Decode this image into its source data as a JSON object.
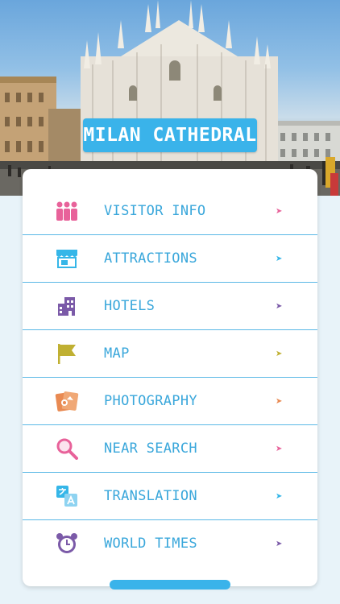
{
  "header": {
    "title": "MILAN CATHEDRAL"
  },
  "menu": {
    "items": [
      {
        "label": "VISITOR INFO",
        "icon": "people-icon",
        "color": "#e8629a",
        "arrow": "➤"
      },
      {
        "label": "ATTRACTIONS",
        "icon": "store-icon",
        "color": "#35b6e8",
        "arrow": "➤"
      },
      {
        "label": "HOTELS",
        "icon": "building-icon",
        "color": "#7b5aa8",
        "arrow": "➤"
      },
      {
        "label": "MAP",
        "icon": "flag-icon",
        "color": "#c0b032",
        "arrow": "➤"
      },
      {
        "label": "PHOTOGRAPHY",
        "icon": "photos-icon",
        "color": "#e98a52",
        "arrow": "➤"
      },
      {
        "label": "NEAR SEARCH",
        "icon": "magnifier-icon",
        "color": "#e8629a",
        "arrow": "➤"
      },
      {
        "label": "TRANSLATION",
        "icon": "translate-icon",
        "color": "#35b6e8",
        "arrow": "➤"
      },
      {
        "label": "WORLD TIMES",
        "icon": "alarm-clock-icon",
        "color": "#7b5aa8",
        "arrow": "➤"
      }
    ]
  },
  "colors": {
    "accent": "#3ab3ea",
    "label": "#3aa7db",
    "divider": "#59b8e6",
    "background": "#e8f3f9"
  }
}
